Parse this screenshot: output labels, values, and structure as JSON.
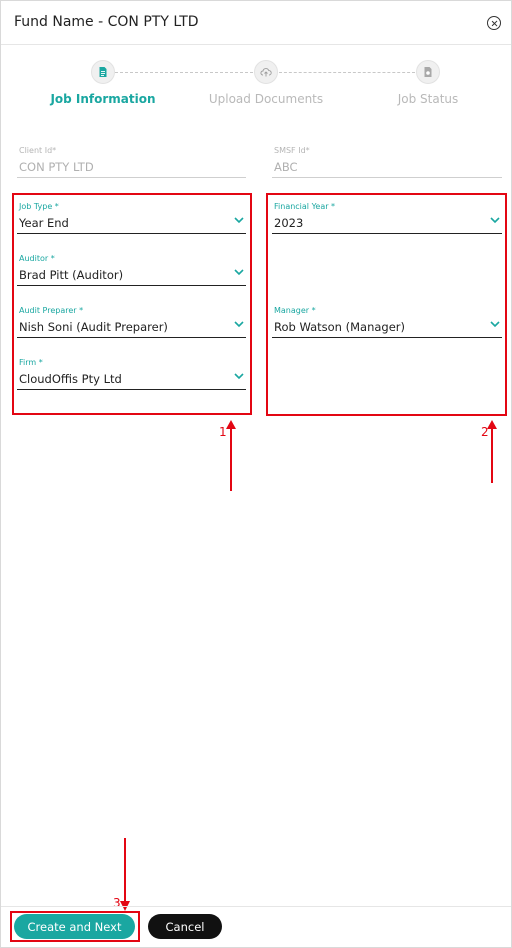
{
  "dialog": {
    "title": "Fund Name - CON PTY LTD",
    "close_icon": "close-circle-icon"
  },
  "stepper": {
    "steps": [
      {
        "label": "Job Information",
        "state": "active",
        "icon": "document-icon"
      },
      {
        "label": "Upload Documents",
        "state": "inactive",
        "icon": "cloud-upload-icon"
      },
      {
        "label": "Job Status",
        "state": "inactive",
        "icon": "status-file-icon"
      }
    ]
  },
  "form": {
    "client_id": {
      "label": "Client Id*",
      "value": "CON PTY LTD"
    },
    "smsf_id": {
      "label": "SMSF Id*",
      "value": "ABC"
    },
    "job_type": {
      "label": "Job Type *",
      "value": "Year End"
    },
    "auditor": {
      "label": "Auditor *",
      "value": "Brad Pitt (Auditor)"
    },
    "audit_preparer": {
      "label": "Audit Preparer *",
      "value": "Nish Soni (Audit Preparer)"
    },
    "firm": {
      "label": "Firm *",
      "value": "CloudOffis Pty Ltd"
    },
    "financial_year": {
      "label": "Financial Year *",
      "value": "2023"
    },
    "manager": {
      "label": "Manager *",
      "value": "Rob Watson (Manager)"
    }
  },
  "annotations": {
    "n1": "1",
    "n2": "2",
    "n3": "3"
  },
  "footer": {
    "create_label": "Create and Next",
    "cancel_label": "Cancel"
  },
  "colors": {
    "accent": "#1aa7a1",
    "annotation": "#e30613",
    "cancel_bg": "#111111"
  }
}
